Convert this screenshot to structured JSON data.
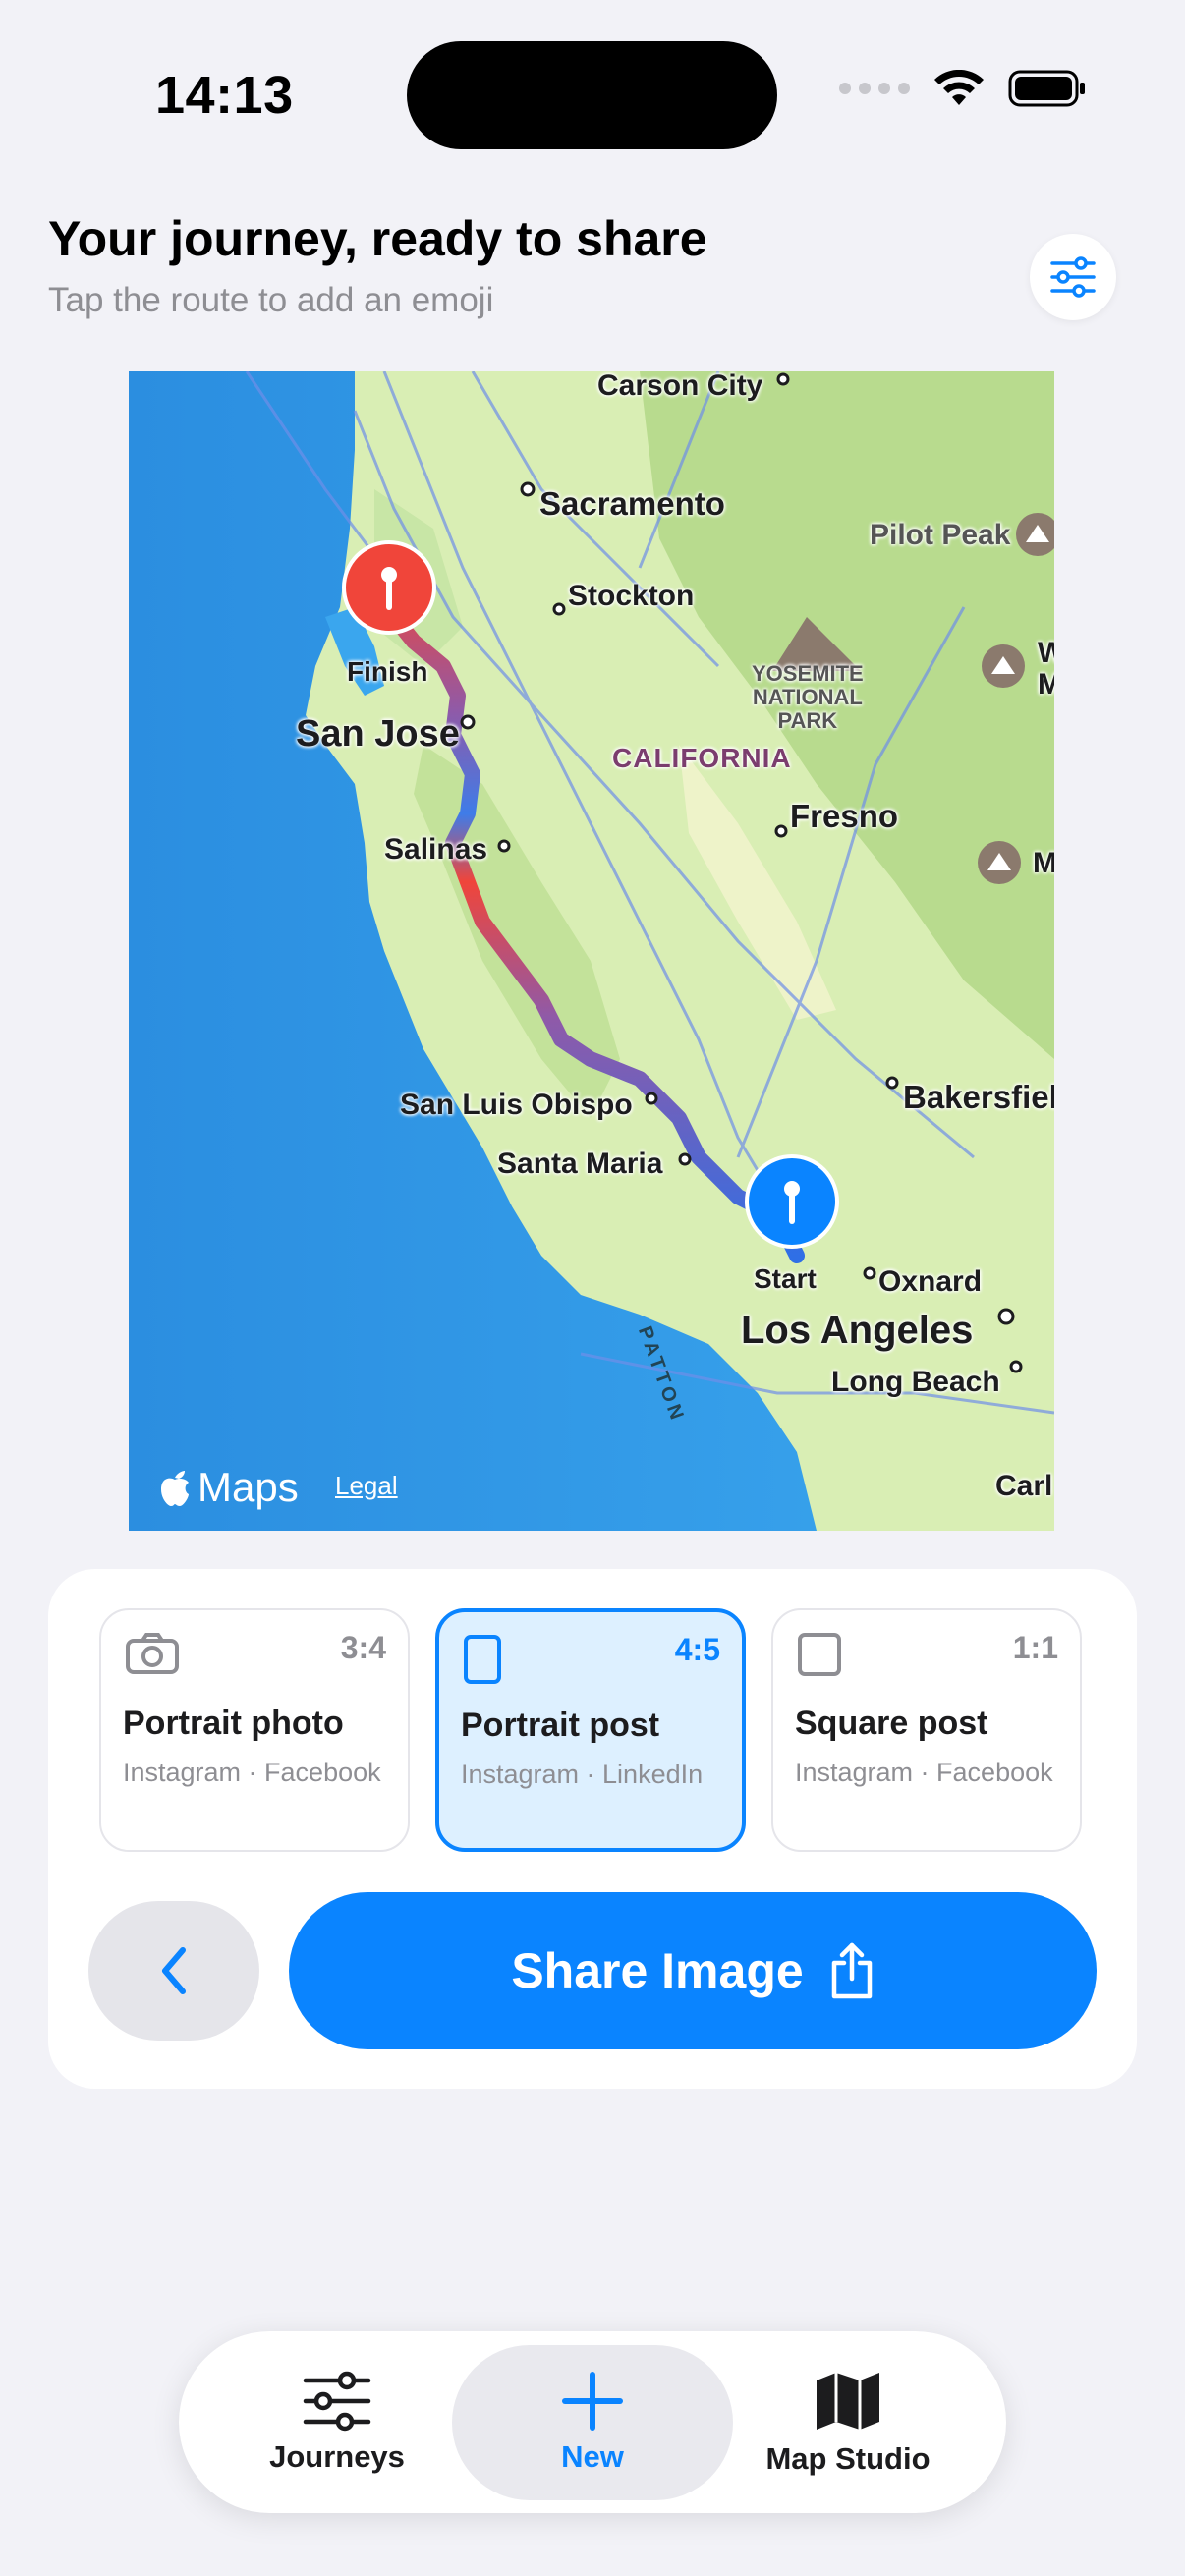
{
  "status": {
    "time": "14:13"
  },
  "header": {
    "title": "Your journey, ready to share",
    "subtitle": "Tap the route to add an emoji",
    "settings_icon": "sliders-icon"
  },
  "map": {
    "labels": {
      "carson_city": "Carson City",
      "sacramento": "Sacramento",
      "stockton": "Stockton",
      "pilot_peak": "Pilot Peak",
      "yosemite": "YOSEMITE\nNATIONAL\nPARK",
      "finish": "Finish",
      "san_jose": "San Jose",
      "california": "CALIFORNIA",
      "fresno": "Fresno",
      "salinas": "Salinas",
      "bakersfield": "Bakersfiel",
      "san_luis_obispo": "San Luis Obispo",
      "santa_maria": "Santa Maria",
      "start": "Start",
      "oxnard": "Oxnard",
      "los_angeles": "Los Angeles",
      "long_beach": "Long Beach",
      "carl": "Carl",
      "patton": "PATTON",
      "w": "W",
      "m1": "M",
      "m2": "M"
    },
    "brand": "Maps",
    "legal": "Legal",
    "colors": {
      "finish_pin": "#f0453a",
      "start_pin": "#0a84ff"
    }
  },
  "formats": [
    {
      "name": "Portrait photo",
      "ratio": "3:4",
      "apps": "Instagram · Facebook",
      "icon": "camera-icon",
      "selected": false
    },
    {
      "name": "Portrait post",
      "ratio": "4:5",
      "apps": "Instagram · LinkedIn",
      "icon": "portrait-rect-icon",
      "selected": true
    },
    {
      "name": "Square post",
      "ratio": "1:1",
      "apps": "Instagram · Facebook",
      "icon": "square-icon",
      "selected": false
    }
  ],
  "actions": {
    "back_icon": "chevron-left-icon",
    "share_label": "Share Image",
    "share_icon": "share-icon"
  },
  "tabs": [
    {
      "label": "Journeys",
      "icon": "sliders-icon",
      "active": false
    },
    {
      "label": "New",
      "icon": "plus-icon",
      "active": true
    },
    {
      "label": "Map Studio",
      "icon": "map-icon",
      "active": false
    }
  ],
  "accent": "#0a84ff"
}
